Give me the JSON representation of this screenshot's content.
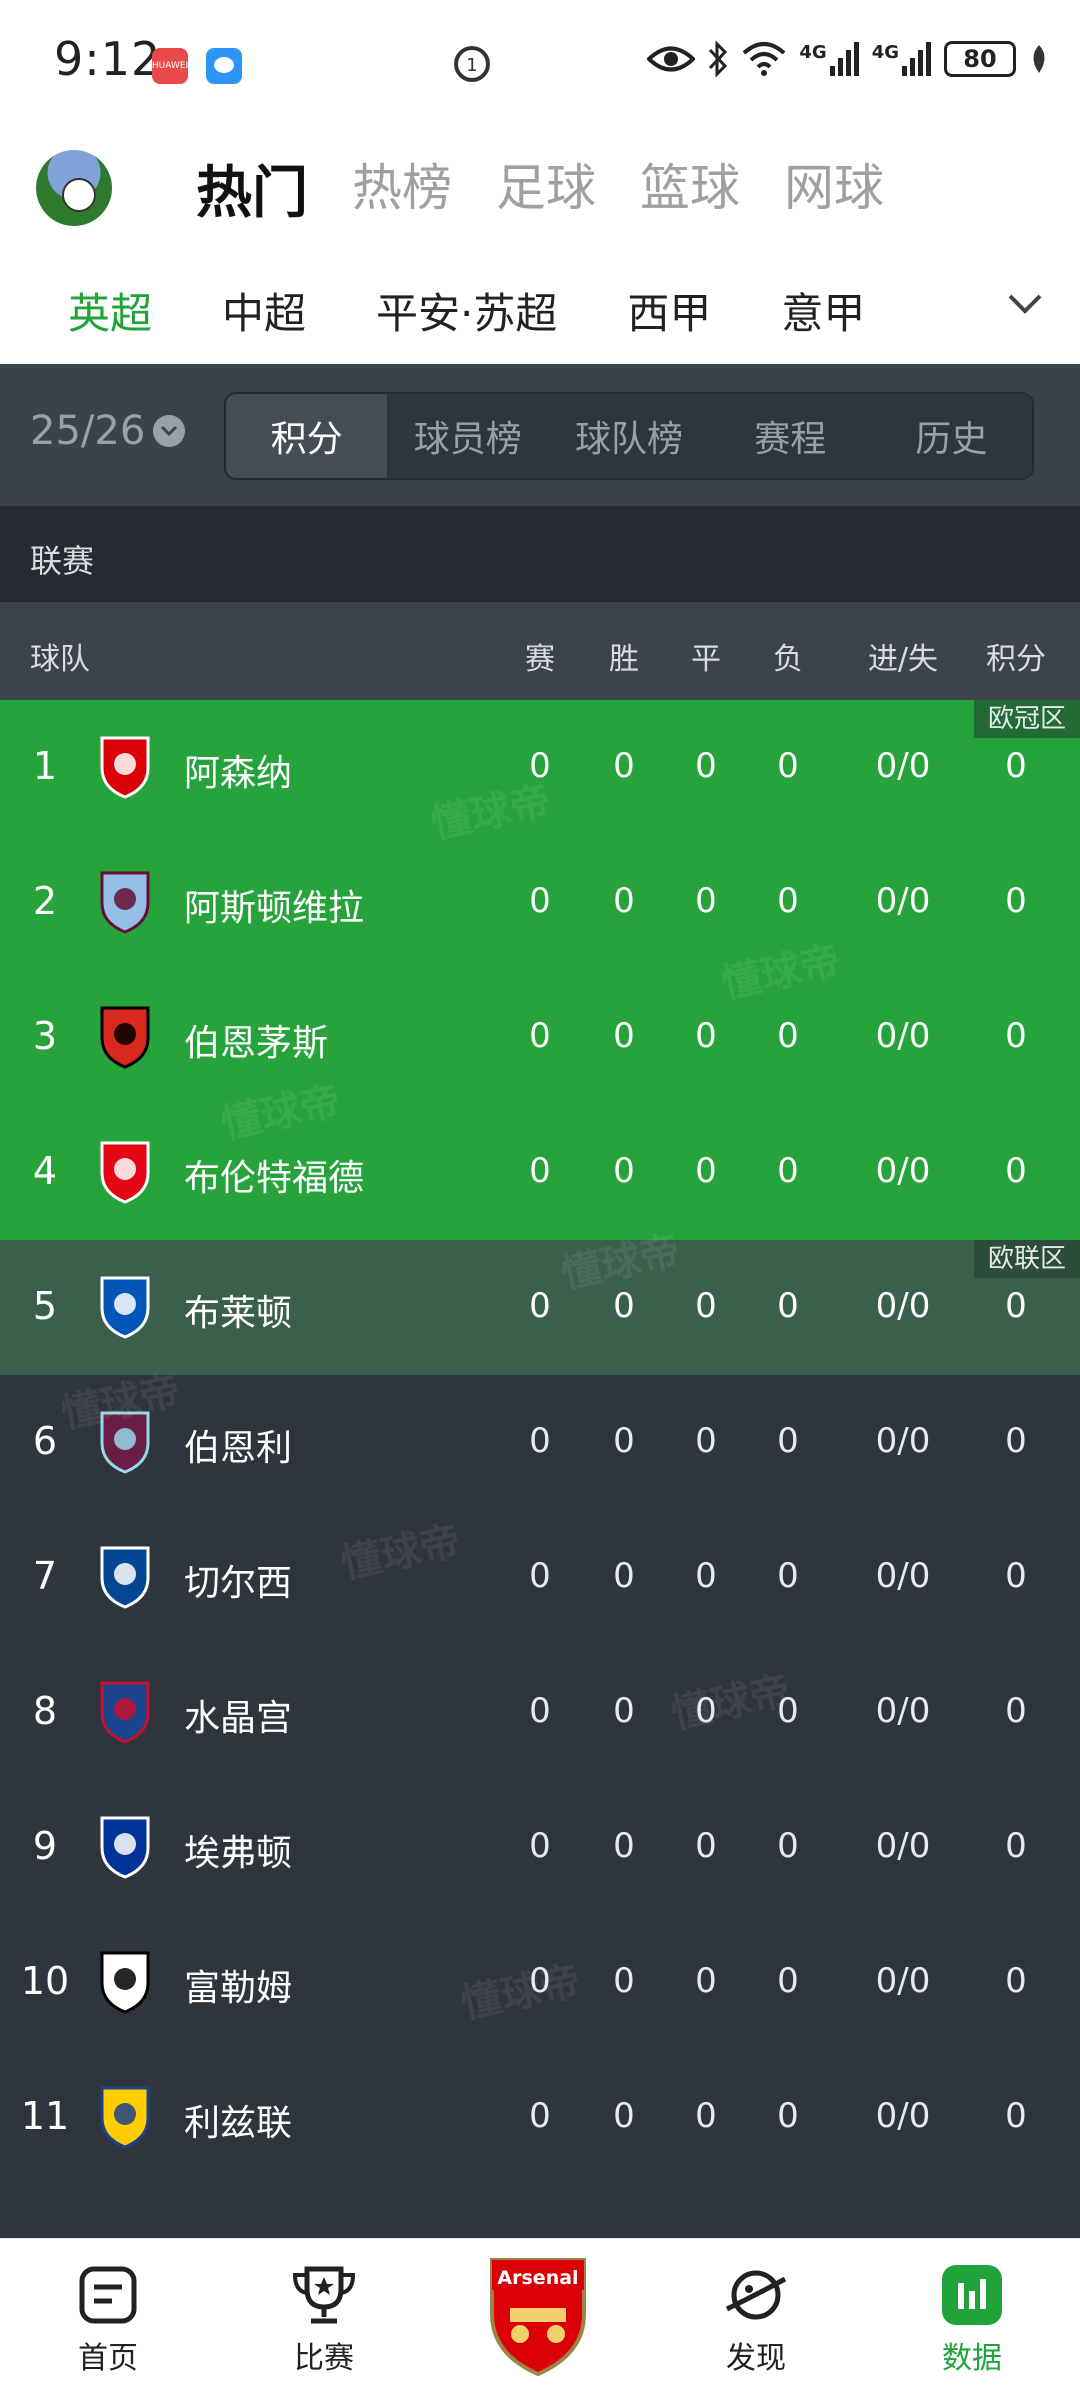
{
  "status_bar": {
    "time": "9:12",
    "app1": "HUAWEI",
    "battery": "80",
    "network1": "4G",
    "network2": "4G"
  },
  "header": {
    "tabs": [
      {
        "label": "热门",
        "active": true
      },
      {
        "label": "热榜"
      },
      {
        "label": "足球"
      },
      {
        "label": "篮球"
      },
      {
        "label": "网球"
      }
    ]
  },
  "leagues": [
    {
      "label": "英超",
      "active": true
    },
    {
      "label": "中超"
    },
    {
      "label": "平安·苏超"
    },
    {
      "label": "西甲"
    },
    {
      "label": "意甲"
    }
  ],
  "filter": {
    "season": "25/26",
    "segments": [
      {
        "label": "积分",
        "active": true
      },
      {
        "label": "球员榜"
      },
      {
        "label": "球队榜"
      },
      {
        "label": "赛程"
      },
      {
        "label": "历史"
      }
    ]
  },
  "section_title": "联赛",
  "table_header": {
    "team": "球队",
    "played": "赛",
    "won": "胜",
    "drawn": "平",
    "lost": "负",
    "goals": "进/失",
    "points": "积分"
  },
  "zones": {
    "ucl": "欧冠区",
    "uel": "欧联区"
  },
  "watermark": "懂球帝",
  "rows": [
    {
      "rank": "1",
      "team": "阿森纳",
      "played": "0",
      "won": "0",
      "drawn": "0",
      "lost": "0",
      "goals": "0/0",
      "points": "0",
      "zone": "ucl",
      "crest_color": "#db0007",
      "crest_alt": "#ffffff"
    },
    {
      "rank": "2",
      "team": "阿斯顿维拉",
      "played": "0",
      "won": "0",
      "drawn": "0",
      "lost": "0",
      "goals": "0/0",
      "points": "0",
      "zone": "ucl",
      "crest_color": "#95bfe5",
      "crest_alt": "#670e36"
    },
    {
      "rank": "3",
      "team": "伯恩茅斯",
      "played": "0",
      "won": "0",
      "drawn": "0",
      "lost": "0",
      "goals": "0/0",
      "points": "0",
      "zone": "ucl",
      "crest_color": "#da291c",
      "crest_alt": "#000000"
    },
    {
      "rank": "4",
      "team": "布伦特福德",
      "played": "0",
      "won": "0",
      "drawn": "0",
      "lost": "0",
      "goals": "0/0",
      "points": "0",
      "zone": "ucl",
      "crest_color": "#e30613",
      "crest_alt": "#ffffff"
    },
    {
      "rank": "5",
      "team": "布莱顿",
      "played": "0",
      "won": "0",
      "drawn": "0",
      "lost": "0",
      "goals": "0/0",
      "points": "0",
      "zone": "uel",
      "crest_color": "#0057b8",
      "crest_alt": "#ffffff"
    },
    {
      "rank": "6",
      "team": "伯恩利",
      "played": "0",
      "won": "0",
      "drawn": "0",
      "lost": "0",
      "goals": "0/0",
      "points": "0",
      "zone": "",
      "crest_color": "#6c1d45",
      "crest_alt": "#99d6ea"
    },
    {
      "rank": "7",
      "team": "切尔西",
      "played": "0",
      "won": "0",
      "drawn": "0",
      "lost": "0",
      "goals": "0/0",
      "points": "0",
      "zone": "",
      "crest_color": "#034694",
      "crest_alt": "#ffffff"
    },
    {
      "rank": "8",
      "team": "水晶宫",
      "played": "0",
      "won": "0",
      "drawn": "0",
      "lost": "0",
      "goals": "0/0",
      "points": "0",
      "zone": "",
      "crest_color": "#1b458f",
      "crest_alt": "#c4122e"
    },
    {
      "rank": "9",
      "team": "埃弗顿",
      "played": "0",
      "won": "0",
      "drawn": "0",
      "lost": "0",
      "goals": "0/0",
      "points": "0",
      "zone": "",
      "crest_color": "#003399",
      "crest_alt": "#ffffff"
    },
    {
      "rank": "10",
      "team": "富勒姆",
      "played": "0",
      "won": "0",
      "drawn": "0",
      "lost": "0",
      "goals": "0/0",
      "points": "0",
      "zone": "",
      "crest_color": "#ffffff",
      "crest_alt": "#000000"
    },
    {
      "rank": "11",
      "team": "利兹联",
      "played": "0",
      "won": "0",
      "drawn": "0",
      "lost": "0",
      "goals": "0/0",
      "points": "0",
      "zone": "",
      "crest_color": "#ffcd00",
      "crest_alt": "#1d428a"
    }
  ],
  "bottom_nav": [
    {
      "label": "首页",
      "icon": "home-icon"
    },
    {
      "label": "比赛",
      "icon": "trophy-icon"
    },
    {
      "label": "",
      "icon": "arsenal-crest-icon",
      "crest_text": "Arsenal"
    },
    {
      "label": "发现",
      "icon": "planet-icon"
    },
    {
      "label": "数据",
      "icon": "chart-icon",
      "active": true
    }
  ]
}
